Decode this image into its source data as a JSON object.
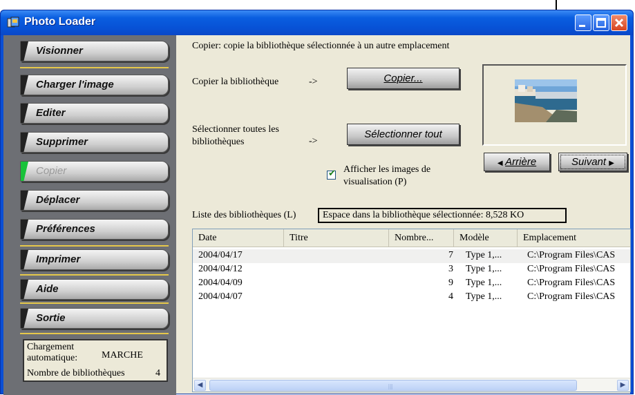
{
  "window": {
    "title": "Photo Loader"
  },
  "sidebar": {
    "items": [
      {
        "label": "Visionner",
        "disabled": false
      },
      {
        "label": "Charger l'image",
        "disabled": false
      },
      {
        "label": "Editer",
        "disabled": false
      },
      {
        "label": "Supprimer",
        "disabled": false
      },
      {
        "label": "Copier",
        "disabled": true
      },
      {
        "label": "Déplacer",
        "disabled": false
      },
      {
        "label": "Préférences",
        "disabled": false
      },
      {
        "label": "Imprimer",
        "disabled": false
      },
      {
        "label": "Aide",
        "disabled": false
      },
      {
        "label": "Sortie",
        "disabled": false
      }
    ],
    "status": {
      "autoload_label": "Chargement automatique:",
      "autoload_value": "MARCHE",
      "libcount_label": "Nombre de bibliothèques",
      "libcount_value": "4"
    }
  },
  "main": {
    "description": "Copier: copie la bibliothèque sélectionnée à un autre emplacement",
    "copy_label": "Copier la bibliothèque",
    "arrow": "->",
    "copy_button": "Copier...",
    "select_label": "Sélectionner toutes les bibliothèques",
    "select_button": "Sélectionner tout",
    "prev_button": "Arrière",
    "next_button": "Suivant",
    "preview_checkbox": {
      "label": "Afficher les images de visualisation (P)",
      "checked": true
    },
    "list_label": "Liste des bibliothèques (L)",
    "space_label": "Espace dans la bibliothèque sélectionnée: 8,528 KO"
  },
  "list": {
    "columns": [
      "Date",
      "Titre",
      "Nombre...",
      "Modèle",
      "Emplacement"
    ],
    "rows": [
      {
        "date": "2004/04/17",
        "title": "",
        "count": "7",
        "model": "Type 1,...",
        "location": "C:\\Program Files\\CAS",
        "selected": true
      },
      {
        "date": "2004/04/12",
        "title": "",
        "count": "3",
        "model": "Type 1,...",
        "location": "C:\\Program Files\\CAS",
        "selected": false
      },
      {
        "date": "2004/04/09",
        "title": "",
        "count": "9",
        "model": "Type 1,...",
        "location": "C:\\Program Files\\CAS",
        "selected": false
      },
      {
        "date": "2004/04/07",
        "title": "",
        "count": "4",
        "model": "Type 1,...",
        "location": "C:\\Program Files\\CAS",
        "selected": false
      }
    ]
  },
  "icons": {
    "app": "photo-loader-icon",
    "minimize": "minimize-icon",
    "maximize": "maximize-icon",
    "close": "close-icon",
    "prev": "triangle-left-icon",
    "next": "triangle-right-icon",
    "check": "checkmark-icon"
  },
  "colors": {
    "titlebar": "#0a5ee0",
    "sidebar": "#6d6f74",
    "separator": "#e6c84a",
    "disabled_notch": "#18c23a",
    "client": "#ece9d8"
  }
}
